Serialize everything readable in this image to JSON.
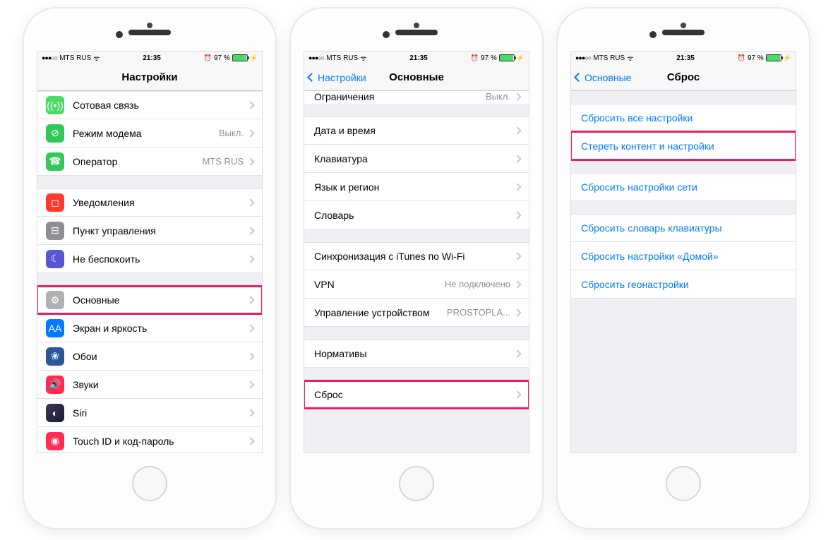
{
  "status": {
    "dots": "●●●○○",
    "carrier": "MTS RUS",
    "time": "21:35",
    "alarm": "⏰",
    "battery_pct": "97 %",
    "bolt": "⚡"
  },
  "phone1": {
    "title": "Настройки",
    "rows_g1": [
      {
        "icon": "cellular-icon",
        "cls": "ic-green",
        "glyph": "((•))",
        "label": "Сотовая связь",
        "value": ""
      },
      {
        "icon": "hotspot-icon",
        "cls": "ic-green2",
        "glyph": "⊘",
        "label": "Режим модема",
        "value": "Выкл."
      },
      {
        "icon": "carrier-icon",
        "cls": "ic-green2",
        "glyph": "☎",
        "label": "Оператор",
        "value": "MTS RUS"
      }
    ],
    "rows_g2": [
      {
        "icon": "notifications-icon",
        "cls": "ic-red",
        "glyph": "◻",
        "label": "Уведомления",
        "value": ""
      },
      {
        "icon": "control-center-icon",
        "cls": "ic-gray",
        "glyph": "⊟",
        "label": "Пункт управления",
        "value": ""
      },
      {
        "icon": "dnd-icon",
        "cls": "ic-purple",
        "glyph": "☾",
        "label": "Не беспокоить",
        "value": ""
      }
    ],
    "rows_g3": [
      {
        "icon": "general-icon",
        "cls": "ic-graylt",
        "glyph": "⚙",
        "label": "Основные",
        "value": "",
        "hl": true
      },
      {
        "icon": "display-icon",
        "cls": "ic-blue",
        "glyph": "AA",
        "label": "Экран и яркость",
        "value": ""
      },
      {
        "icon": "wallpaper-icon",
        "cls": "ic-darkblue",
        "glyph": "❀",
        "label": "Обои",
        "value": ""
      },
      {
        "icon": "sounds-icon",
        "cls": "ic-pink",
        "glyph": "🔊",
        "label": "Звуки",
        "value": ""
      },
      {
        "icon": "siri-icon",
        "cls": "ic-siri",
        "glyph": "◐",
        "label": "Siri",
        "value": ""
      },
      {
        "icon": "touchid-icon",
        "cls": "ic-touch",
        "glyph": "◉",
        "label": "Touch ID и код-пароль",
        "value": ""
      }
    ]
  },
  "phone2": {
    "back": "Настройки",
    "title": "Основные",
    "partial_top": {
      "label": "Ограничения",
      "value": "Выкл."
    },
    "rows_g1": [
      {
        "label": "Дата и время",
        "value": ""
      },
      {
        "label": "Клавиатура",
        "value": ""
      },
      {
        "label": "Язык и регион",
        "value": ""
      },
      {
        "label": "Словарь",
        "value": ""
      }
    ],
    "rows_g2": [
      {
        "label": "Синхронизация с iTunes по Wi-Fi",
        "value": ""
      },
      {
        "label": "VPN",
        "value": "Не подключено"
      },
      {
        "label": "Управление устройством",
        "value": "PROSTOPLA..."
      }
    ],
    "rows_g3": [
      {
        "label": "Нормативы",
        "value": ""
      }
    ],
    "rows_g4": [
      {
        "label": "Сброс",
        "value": "",
        "hl": true
      }
    ]
  },
  "phone3": {
    "back": "Основные",
    "title": "Сброс",
    "rows_g1": [
      {
        "label": "Сбросить все настройки"
      },
      {
        "label": "Стереть контент и настройки",
        "hl": true
      }
    ],
    "rows_g2": [
      {
        "label": "Сбросить настройки сети"
      }
    ],
    "rows_g3": [
      {
        "label": "Сбросить словарь клавиатуры"
      },
      {
        "label": "Сбросить настройки «Домой»"
      },
      {
        "label": "Сбросить геонастройки"
      }
    ]
  }
}
